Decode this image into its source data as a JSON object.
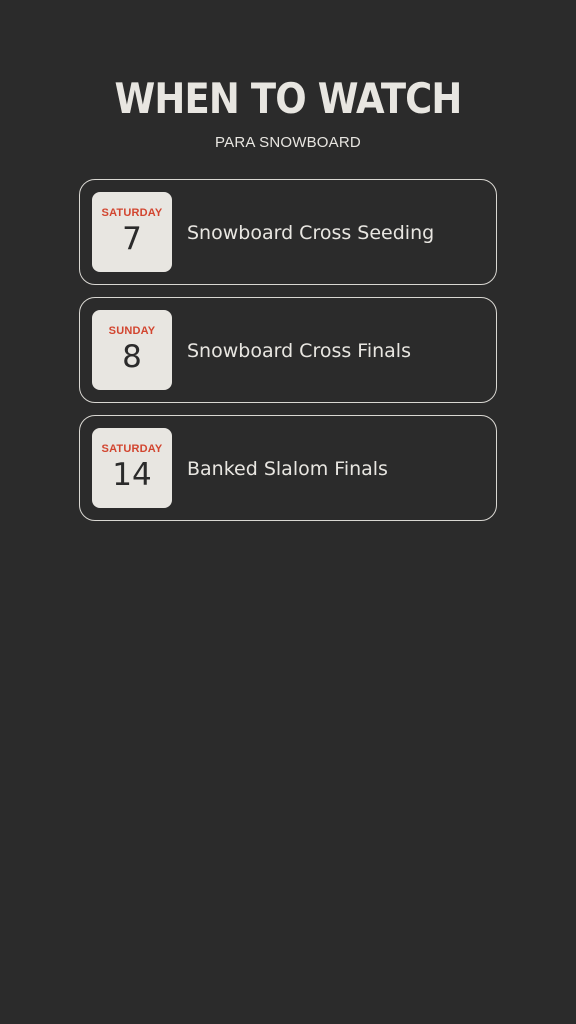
{
  "header": {
    "title": "WHEN TO WATCH",
    "subtitle": "PARA SNOWBOARD"
  },
  "events": [
    {
      "day": "SATURDAY",
      "date": "7",
      "name": "Snowboard Cross Seeding"
    },
    {
      "day": "SUNDAY",
      "date": "8",
      "name": "Snowboard Cross Finals"
    },
    {
      "day": "SATURDAY",
      "date": "14",
      "name": "Banked Slalom Finals"
    }
  ],
  "colors": {
    "background": "#2b2b2b",
    "text": "#e8e6e1",
    "accent": "#d2452f"
  }
}
